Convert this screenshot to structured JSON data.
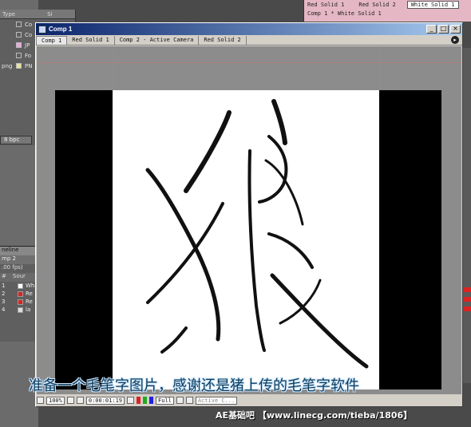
{
  "project": {
    "column_type": "Type",
    "column_size": "Si",
    "rows": [
      {
        "label": "Co",
        "color": "#d0d0d0"
      },
      {
        "label": "Co",
        "color": "#d0d0d0"
      },
      {
        "label": "JP",
        "color": "#e7a9e0"
      },
      {
        "label": "Fo",
        "color": "#d0d0d0"
      },
      {
        "label": "PN",
        "color": "#e6e2a0"
      }
    ],
    "left_file_ext": "png",
    "bit_depth": "8 bpc"
  },
  "timeline": {
    "title": "neline",
    "tab": "mp 2",
    "fps": ".00 fps)",
    "col_num": "#",
    "col_source": "Sour",
    "layers": [
      {
        "num": "1",
        "name": "Wh",
        "color": "#ffffff"
      },
      {
        "num": "2",
        "name": "Re",
        "color": "#dd2222"
      },
      {
        "num": "3",
        "name": "Re",
        "color": "#dd2222"
      },
      {
        "num": "4",
        "name": "la",
        "color": "#dddddd"
      }
    ]
  },
  "right_panel": {
    "tabs": [
      "Red Solid 1",
      "Red Solid 2",
      "White Solid 1"
    ],
    "path": "Comp 1 * White Solid 1"
  },
  "comp_window": {
    "title": "Comp 1",
    "buttons": {
      "minimize": "_",
      "maximize": "□",
      "close": "×"
    },
    "tabs": [
      "Comp 1",
      "Red Solid 1",
      "Comp 2 - Active Camera",
      "Red Solid 2"
    ],
    "active_tab": "Comp 1",
    "footer": {
      "zoom": "100%",
      "timecode": "0:00:01:19",
      "resolution": "Full",
      "view": "Active C..."
    }
  },
  "artwork": {
    "glyph": "狼",
    "stroke_color": "#111111"
  },
  "overlay": {
    "caption": "准备一个毛笔字图片，感谢还是猪上传的毛笔字软件",
    "watermark": "AE基础吧  【www.linecg.com/tieba/1806】"
  }
}
